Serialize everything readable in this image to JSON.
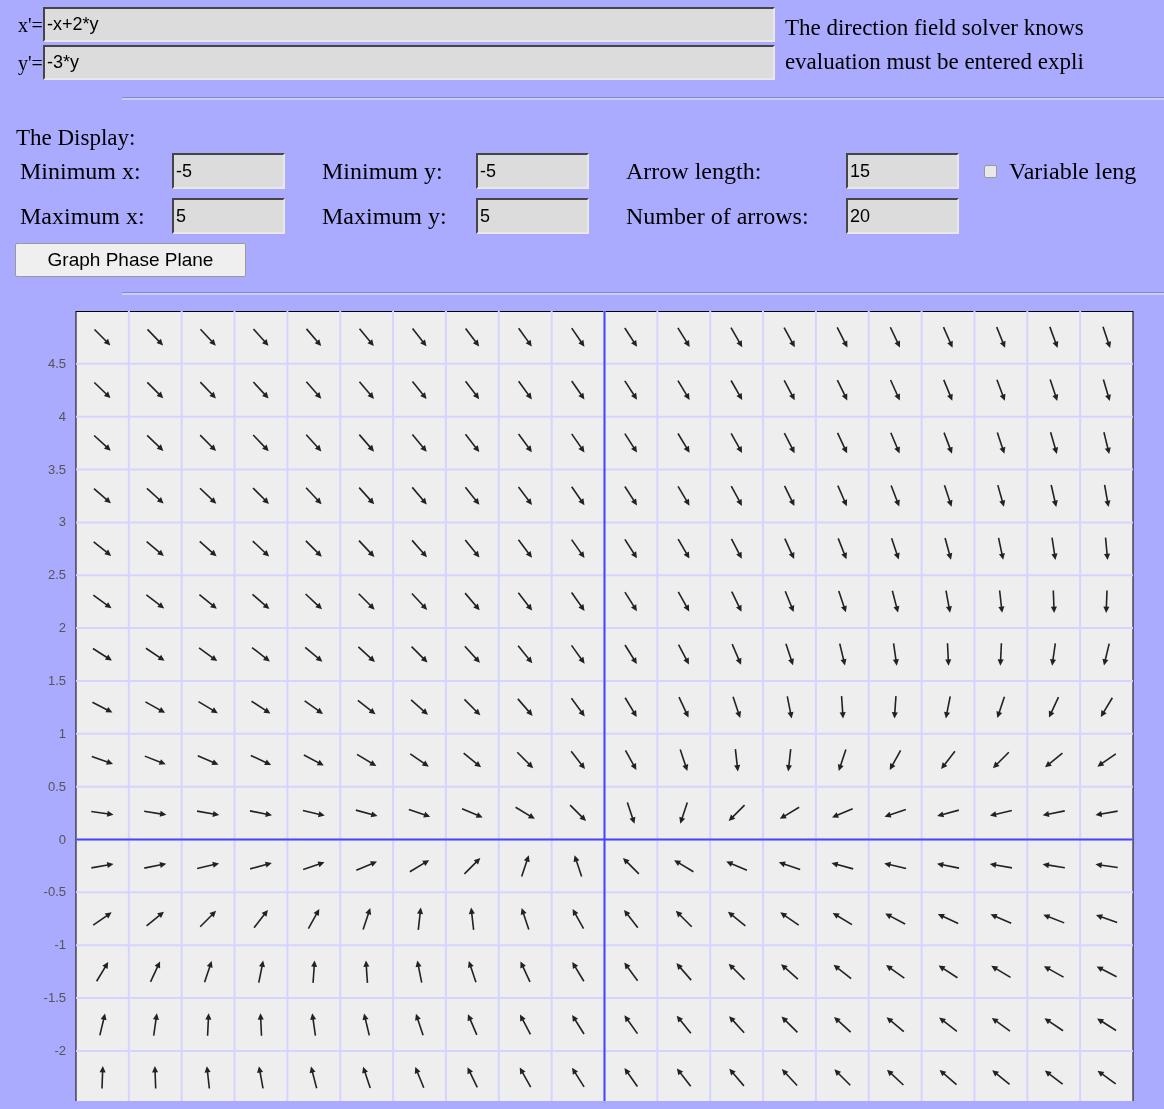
{
  "equations": [
    {
      "label": "x'=",
      "value": "-x+2*y"
    },
    {
      "label": "y'=",
      "value": "-3*y"
    }
  ],
  "note_lines": [
    "The direction field solver knows",
    "evaluation must be entered expli"
  ],
  "display": {
    "heading": "The Display:",
    "fields": [
      {
        "label": "Minimum x:",
        "value": "-5"
      },
      {
        "label": "Minimum y:",
        "value": "-5"
      },
      {
        "label": "Arrow length:",
        "value": "15"
      },
      {
        "label": "Maximum x:",
        "value": "5"
      },
      {
        "label": "Maximum y:",
        "value": "5"
      },
      {
        "label": "Number of arrows:",
        "value": "20"
      }
    ],
    "variable_length": {
      "label": "Variable leng",
      "checked": false
    }
  },
  "button": "Graph Phase Plane",
  "plot": {
    "y_tick_labels": [
      "4.5",
      "4",
      "3.5",
      "3",
      "2.5",
      "2",
      "1.5",
      "1",
      "0.5",
      "0",
      "-0.5",
      "-1",
      "-1.5",
      "-2"
    ]
  }
}
